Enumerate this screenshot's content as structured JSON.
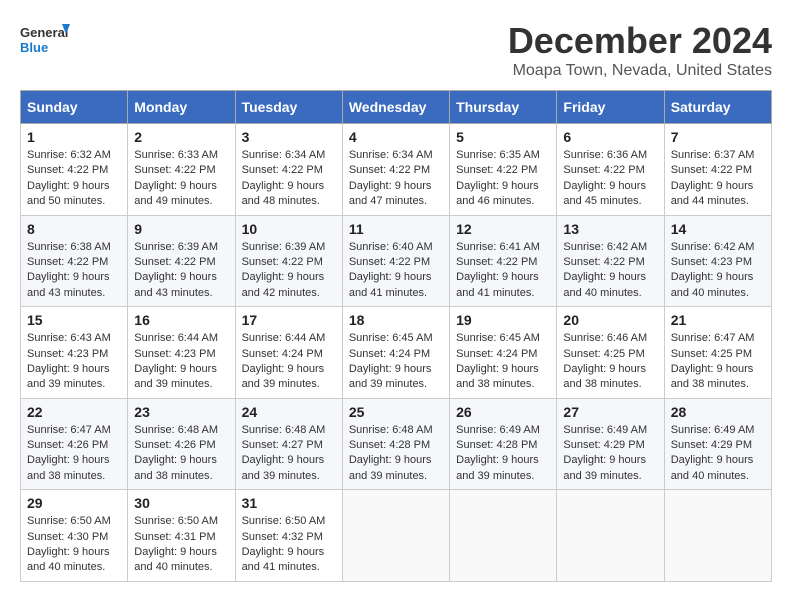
{
  "logo": {
    "line1": "General",
    "line2": "Blue"
  },
  "title": "December 2024",
  "subtitle": "Moapa Town, Nevada, United States",
  "days_of_week": [
    "Sunday",
    "Monday",
    "Tuesday",
    "Wednesday",
    "Thursday",
    "Friday",
    "Saturday"
  ],
  "weeks": [
    [
      {
        "day": "1",
        "info": "Sunrise: 6:32 AM\nSunset: 4:22 PM\nDaylight: 9 hours\nand 50 minutes."
      },
      {
        "day": "2",
        "info": "Sunrise: 6:33 AM\nSunset: 4:22 PM\nDaylight: 9 hours\nand 49 minutes."
      },
      {
        "day": "3",
        "info": "Sunrise: 6:34 AM\nSunset: 4:22 PM\nDaylight: 9 hours\nand 48 minutes."
      },
      {
        "day": "4",
        "info": "Sunrise: 6:34 AM\nSunset: 4:22 PM\nDaylight: 9 hours\nand 47 minutes."
      },
      {
        "day": "5",
        "info": "Sunrise: 6:35 AM\nSunset: 4:22 PM\nDaylight: 9 hours\nand 46 minutes."
      },
      {
        "day": "6",
        "info": "Sunrise: 6:36 AM\nSunset: 4:22 PM\nDaylight: 9 hours\nand 45 minutes."
      },
      {
        "day": "7",
        "info": "Sunrise: 6:37 AM\nSunset: 4:22 PM\nDaylight: 9 hours\nand 44 minutes."
      }
    ],
    [
      {
        "day": "8",
        "info": "Sunrise: 6:38 AM\nSunset: 4:22 PM\nDaylight: 9 hours\nand 43 minutes."
      },
      {
        "day": "9",
        "info": "Sunrise: 6:39 AM\nSunset: 4:22 PM\nDaylight: 9 hours\nand 43 minutes."
      },
      {
        "day": "10",
        "info": "Sunrise: 6:39 AM\nSunset: 4:22 PM\nDaylight: 9 hours\nand 42 minutes."
      },
      {
        "day": "11",
        "info": "Sunrise: 6:40 AM\nSunset: 4:22 PM\nDaylight: 9 hours\nand 41 minutes."
      },
      {
        "day": "12",
        "info": "Sunrise: 6:41 AM\nSunset: 4:22 PM\nDaylight: 9 hours\nand 41 minutes."
      },
      {
        "day": "13",
        "info": "Sunrise: 6:42 AM\nSunset: 4:22 PM\nDaylight: 9 hours\nand 40 minutes."
      },
      {
        "day": "14",
        "info": "Sunrise: 6:42 AM\nSunset: 4:23 PM\nDaylight: 9 hours\nand 40 minutes."
      }
    ],
    [
      {
        "day": "15",
        "info": "Sunrise: 6:43 AM\nSunset: 4:23 PM\nDaylight: 9 hours\nand 39 minutes."
      },
      {
        "day": "16",
        "info": "Sunrise: 6:44 AM\nSunset: 4:23 PM\nDaylight: 9 hours\nand 39 minutes."
      },
      {
        "day": "17",
        "info": "Sunrise: 6:44 AM\nSunset: 4:24 PM\nDaylight: 9 hours\nand 39 minutes."
      },
      {
        "day": "18",
        "info": "Sunrise: 6:45 AM\nSunset: 4:24 PM\nDaylight: 9 hours\nand 39 minutes."
      },
      {
        "day": "19",
        "info": "Sunrise: 6:45 AM\nSunset: 4:24 PM\nDaylight: 9 hours\nand 38 minutes."
      },
      {
        "day": "20",
        "info": "Sunrise: 6:46 AM\nSunset: 4:25 PM\nDaylight: 9 hours\nand 38 minutes."
      },
      {
        "day": "21",
        "info": "Sunrise: 6:47 AM\nSunset: 4:25 PM\nDaylight: 9 hours\nand 38 minutes."
      }
    ],
    [
      {
        "day": "22",
        "info": "Sunrise: 6:47 AM\nSunset: 4:26 PM\nDaylight: 9 hours\nand 38 minutes."
      },
      {
        "day": "23",
        "info": "Sunrise: 6:48 AM\nSunset: 4:26 PM\nDaylight: 9 hours\nand 38 minutes."
      },
      {
        "day": "24",
        "info": "Sunrise: 6:48 AM\nSunset: 4:27 PM\nDaylight: 9 hours\nand 39 minutes."
      },
      {
        "day": "25",
        "info": "Sunrise: 6:48 AM\nSunset: 4:28 PM\nDaylight: 9 hours\nand 39 minutes."
      },
      {
        "day": "26",
        "info": "Sunrise: 6:49 AM\nSunset: 4:28 PM\nDaylight: 9 hours\nand 39 minutes."
      },
      {
        "day": "27",
        "info": "Sunrise: 6:49 AM\nSunset: 4:29 PM\nDaylight: 9 hours\nand 39 minutes."
      },
      {
        "day": "28",
        "info": "Sunrise: 6:49 AM\nSunset: 4:29 PM\nDaylight: 9 hours\nand 40 minutes."
      }
    ],
    [
      {
        "day": "29",
        "info": "Sunrise: 6:50 AM\nSunset: 4:30 PM\nDaylight: 9 hours\nand 40 minutes."
      },
      {
        "day": "30",
        "info": "Sunrise: 6:50 AM\nSunset: 4:31 PM\nDaylight: 9 hours\nand 40 minutes."
      },
      {
        "day": "31",
        "info": "Sunrise: 6:50 AM\nSunset: 4:32 PM\nDaylight: 9 hours\nand 41 minutes."
      },
      {
        "day": "",
        "info": ""
      },
      {
        "day": "",
        "info": ""
      },
      {
        "day": "",
        "info": ""
      },
      {
        "day": "",
        "info": ""
      }
    ]
  ]
}
